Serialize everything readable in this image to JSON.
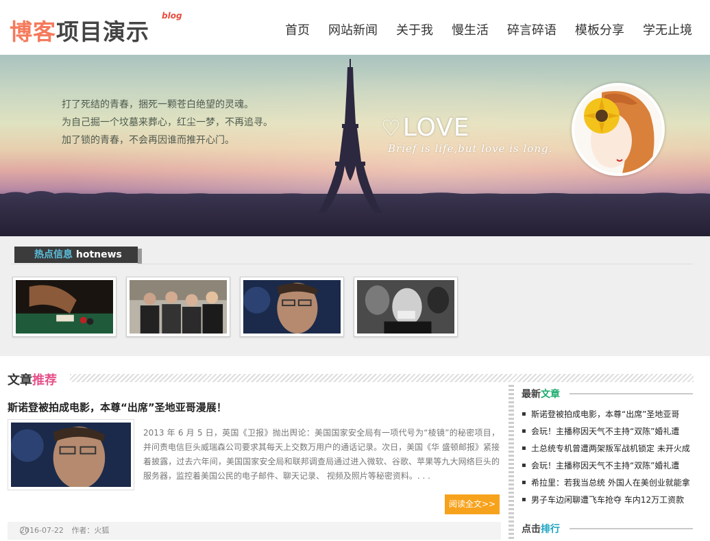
{
  "header": {
    "logo_part1": "博客",
    "logo_part2": "项目演示",
    "logo_sup": "blog",
    "nav": [
      "首页",
      "网站新闻",
      "关于我",
      "慢生活",
      "碎言碎语",
      "模板分享",
      "学无止境"
    ]
  },
  "banner": {
    "lines": [
      "打了死结的青春，捆死一颗苍白绝望的灵魂。",
      "为自己掘一个坟墓来葬心，红尘一梦，不再追寻。",
      "加了锁的青春，不会再因谁而推开心门。"
    ],
    "love": "LOVE",
    "love_heart": "♡",
    "slogan": "Brief is life,but love is long."
  },
  "hotnews": {
    "label_cn": "热点信息",
    "label_en": "hotnews"
  },
  "article_section": {
    "title_part1": "文章",
    "title_part2": "推荐",
    "title": "斯诺登被拍成电影，本尊“出席”圣地亚哥漫展！",
    "body": "2013 年 6 月 5 日，英国《卫报》抛出舆论：美国国家安全局有一项代号为“棱镜”的秘密项目，并问责电信巨头威瑞森公司要求其每天上交数万用户的通话记录。次日，美国《华 盛顿邮报》紧接着披露，过去六年间，美国国家安全局和联邦调查局通过进入微软、谷歌、苹果等九大网络巨头的服务器，监控着美国公民的电子邮件、聊天记录、 视频及照片等秘密资料。. . .",
    "read_more": "阅读全文>>",
    "date": "2016-07-22",
    "author": "作者：火狐"
  },
  "sidebar": {
    "latest_part1": "最新",
    "latest_part2": "文章",
    "latest_items": [
      "斯诺登被拍成电影，本尊“出席”圣地亚哥",
      "会玩！主播称因天气不主持“双陈”婚礼遭",
      "土总统专机曾遭两架叛军战机锁定 未开火成",
      "会玩！主播称因天气不主持“双陈”婚礼遭",
      "希拉里：若我当总统 外国人在美创业就能拿",
      "男子车边闲聊遭飞车抢夺 车内12万工资款"
    ],
    "rank_part1": "点击",
    "rank_part2": "排行"
  },
  "colors": {
    "logo_accent": "#f47a5c",
    "recommend_accent": "#e6508a",
    "read_more_bg": "#f7a21c",
    "hotnews_accent": "#5bc0de"
  }
}
